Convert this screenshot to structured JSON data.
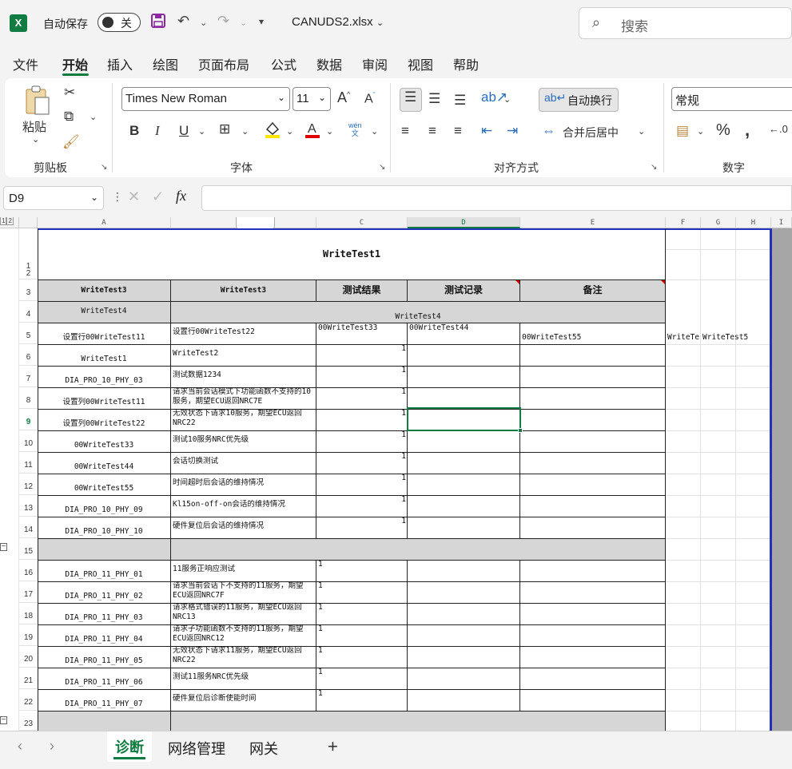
{
  "titlebar": {
    "autosave_label": "自动保存",
    "toggle_state": "关",
    "filename": "CANUDS2.xlsx",
    "search_placeholder": "搜索"
  },
  "menu": [
    "文件",
    "开始",
    "插入",
    "绘图",
    "页面布局",
    "公式",
    "数据",
    "审阅",
    "视图",
    "帮助"
  ],
  "active_menu": "开始",
  "ribbon": {
    "paste_label": "粘贴",
    "clipboard_group": "剪贴板",
    "font_name": "Times New Roman",
    "font_size": "11",
    "font_group": "字体",
    "wrap_text": "自动换行",
    "merge_center": "合并后居中",
    "align_group": "对齐方式",
    "number_format": "常规",
    "number_group": "数字",
    "phonetic_top": "wén",
    "phonetic_bottom": "文"
  },
  "formula": {
    "name_box": "D9",
    "content": ""
  },
  "columns": [
    "A",
    "B",
    "C",
    "D",
    "E",
    "F",
    "G",
    "H",
    "I"
  ],
  "column_b_label": "",
  "rows": [
    "1",
    "2",
    "3",
    "4",
    "5",
    "6",
    "7",
    "8",
    "9",
    "10",
    "11",
    "12",
    "13",
    "14",
    "15",
    "16",
    "17",
    "18",
    "19",
    "20",
    "21",
    "22",
    "23"
  ],
  "sheet": {
    "title": "WriteTest1",
    "headers": [
      "WriteTest3",
      "WriteTest3",
      "测试结果",
      "测试记录",
      "备注"
    ],
    "row4_a": "WriteTest4",
    "row4_merged": "WriteTest4",
    "row5": [
      "设置行00WriteTest11",
      "设置行00WriteTest22",
      "00WriteTest33",
      "00WriteTest44",
      "00WriteTest55",
      "WriteTe",
      "WriteTest5"
    ],
    "rows_6_14": [
      {
        "a": "WriteTest1",
        "b": "WriteTest2",
        "c": "1"
      },
      {
        "a": "DIA_PRO_10_PHY_03",
        "b": "测试数据1234",
        "c": "1"
      },
      {
        "a": "设置列00WriteTest11",
        "b": "请求当前会话模式下功能函数不支持的10服务，期望ECU返回NRC7E",
        "c": "1"
      },
      {
        "a": "设置列00WriteTest22",
        "b": "无效状态下请求10服务，期望ECU返回NRC22",
        "c": "1"
      },
      {
        "a": "00WriteTest33",
        "b": "测试10服务NRC优先级",
        "c": "1"
      },
      {
        "a": "00WriteTest44",
        "b": "会话切换测试",
        "c": "1"
      },
      {
        "a": "00WriteTest55",
        "b": "时间超时后会话的维持情况",
        "c": "1"
      },
      {
        "a": "DIA_PRO_10_PHY_09",
        "b": "Kl15on-off-on会话的维持情况",
        "c": "1"
      },
      {
        "a": "DIA_PRO_10_PHY_10",
        "b": "硬件复位后会话的维持情况",
        "c": "1"
      }
    ],
    "rows_16_22": [
      {
        "a": "DIA_PRO_11_PHY_01",
        "b": "11服务正响应测试",
        "c": "1"
      },
      {
        "a": "DIA_PRO_11_PHY_02",
        "b": "请求当前会话下不支持的11服务，期望ECU返回NRC7F",
        "c": "1"
      },
      {
        "a": "DIA_PRO_11_PHY_03",
        "b": "请求格式错误的11服务，期望ECU返回NRC13",
        "c": "1"
      },
      {
        "a": "DIA_PRO_11_PHY_04",
        "b": "请求子功能函数不支持的11服务，期望ECU返回NRC12",
        "c": "1"
      },
      {
        "a": "DIA_PRO_11_PHY_05",
        "b": "无效状态下请求11服务，期望ECU返回NRC22",
        "c": "1"
      },
      {
        "a": "DIA_PRO_11_PHY_06",
        "b": "测试11服务NRC优先级",
        "c": "1"
      },
      {
        "a": "DIA_PRO_11_PHY_07",
        "b": "硬件复位后诊断使能时间",
        "c": "1"
      }
    ]
  },
  "sheet_tabs": [
    "诊断",
    "网络管理",
    "网关"
  ],
  "active_sheet": "诊断",
  "colors": {
    "accent": "#107c41",
    "header_fill": "#d6d6d6",
    "selection": "#107c41"
  }
}
